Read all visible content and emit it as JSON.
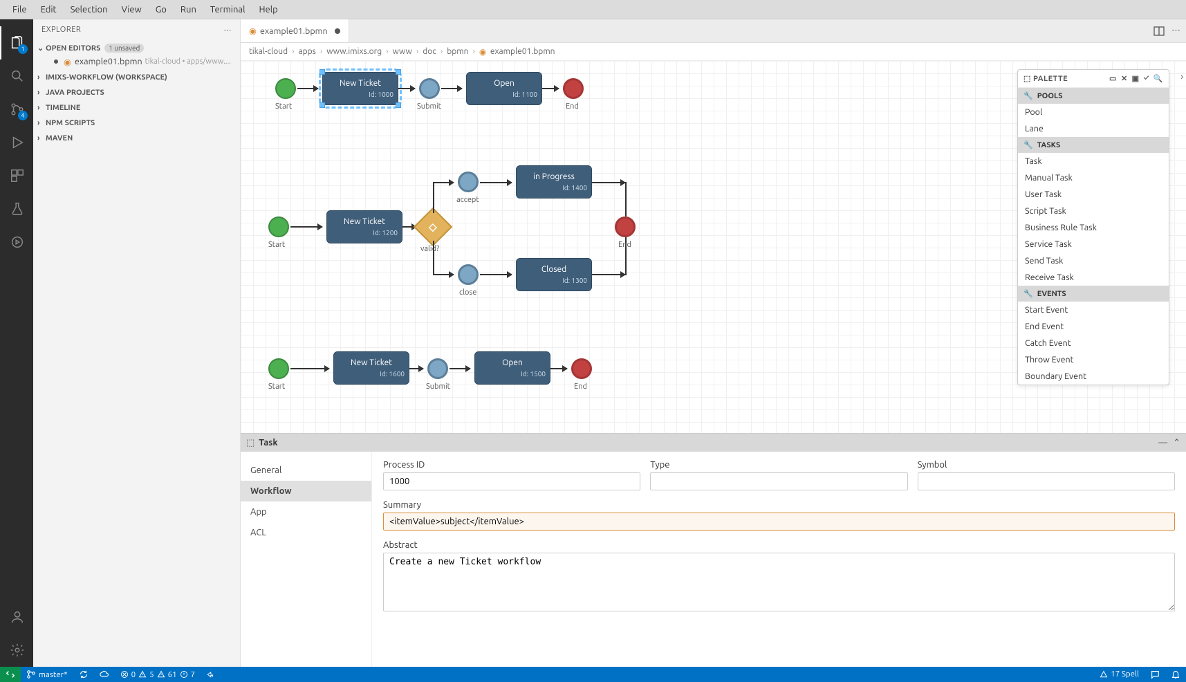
{
  "menubar": [
    "File",
    "Edit",
    "Selection",
    "View",
    "Go",
    "Run",
    "Terminal",
    "Help"
  ],
  "sidebar": {
    "title": "EXPLORER",
    "sections": {
      "openEditors": {
        "label": "OPEN EDITORS",
        "unsaved": "1 unsaved"
      },
      "workspace": {
        "label": "IMIXS-WORKFLOW (WORKSPACE)"
      },
      "javaProjects": {
        "label": "JAVA PROJECTS"
      },
      "timeline": {
        "label": "TIMELINE"
      },
      "npm": {
        "label": "NPM SCRIPTS"
      },
      "maven": {
        "label": "MAVEN"
      }
    },
    "openFile": {
      "name": "example01.bpmn",
      "hint": "tikal-cloud • apps/www...."
    }
  },
  "tab": {
    "label": "example01.bpmn"
  },
  "breadcrumbs": [
    "tikal-cloud",
    "apps",
    "www.imixs.org",
    "www",
    "doc",
    "bpmn",
    "example01.bpmn"
  ],
  "activity": {
    "explorerBadge": "1",
    "scmBadge": "4"
  },
  "diagram": {
    "flow1": {
      "start": "Start",
      "task": "New Ticket",
      "taskId": "Id: 1000",
      "inter": "Submit",
      "task2": "Open",
      "task2Id": "Id: 1100",
      "end": "End"
    },
    "flow2": {
      "start": "Start",
      "task": "New Ticket",
      "taskId": "Id: 1200",
      "gateway": "valid?",
      "interA": "accept",
      "taskA": "in Progress",
      "taskAId": "Id: 1400",
      "interB": "close",
      "taskB": "Closed",
      "taskBId": "Id: 1300",
      "end": "End"
    },
    "flow3": {
      "start": "Start",
      "task": "New Ticket",
      "taskId": "Id: 1600",
      "inter": "Submit",
      "task2": "Open",
      "task2Id": "Id: 1500",
      "end": "End"
    }
  },
  "palette": {
    "title": "PALETTE",
    "groups": [
      {
        "title": "POOLS",
        "items": [
          "Pool",
          "Lane"
        ]
      },
      {
        "title": "TASKS",
        "items": [
          "Task",
          "Manual Task",
          "User Task",
          "Script Task",
          "Business Rule Task",
          "Service Task",
          "Send Task",
          "Receive Task"
        ]
      },
      {
        "title": "EVENTS",
        "items": [
          "Start Event",
          "End Event",
          "Catch Event",
          "Throw Event",
          "Boundary Event"
        ]
      }
    ]
  },
  "props": {
    "title": "Task",
    "tabs": [
      "General",
      "Workflow",
      "App",
      "ACL"
    ],
    "activeTab": "Workflow",
    "fields": {
      "processId": {
        "label": "Process ID",
        "value": "1000"
      },
      "type": {
        "label": "Type",
        "value": ""
      },
      "symbol": {
        "label": "Symbol",
        "value": ""
      },
      "summary": {
        "label": "Summary",
        "value": "<itemValue>subject</itemValue>"
      },
      "abstract": {
        "label": "Abstract",
        "value": "Create a new Ticket workflow"
      }
    }
  },
  "statusbar": {
    "branch": "master*",
    "errors": "0",
    "warn5": "5",
    "warn61": "61",
    "info": "7",
    "spell": "17 Spell"
  }
}
